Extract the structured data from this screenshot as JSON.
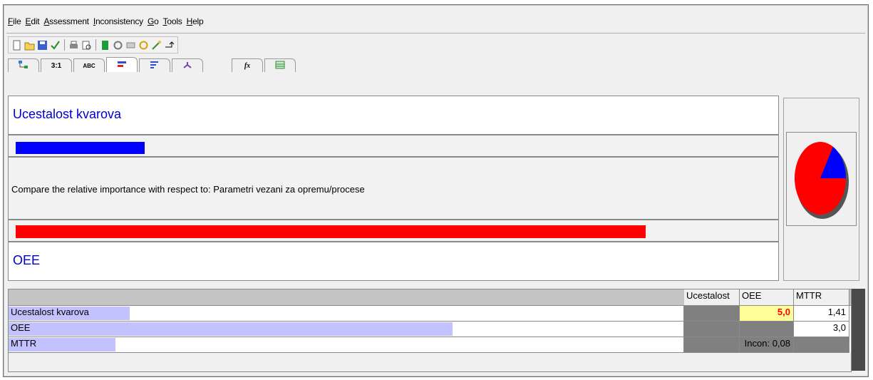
{
  "menu": [
    {
      "label": "File",
      "ul": "F",
      "rest": "ile"
    },
    {
      "label": "Edit",
      "ul": "E",
      "rest": "dit"
    },
    {
      "label": "Assessment",
      "ul": "A",
      "rest": "ssessment"
    },
    {
      "label": "Inconsistency",
      "ul": "I",
      "rest": "nconsistency"
    },
    {
      "label": "Go",
      "ul": "G",
      "rest": "o"
    },
    {
      "label": "Tools",
      "ul": "T",
      "rest": "ools"
    },
    {
      "label": "Help",
      "ul": "H",
      "rest": "elp"
    }
  ],
  "tabs": [
    "tree-icon",
    "3:1",
    "ABC",
    "bar-chart-icon",
    "bars-icon",
    "hierarchy-icon",
    "fx",
    "table-icon"
  ],
  "tab_3to1_label": "3:1",
  "tab_abc_label": "ABC",
  "tab_fx_label": "fx",
  "comparison": {
    "top_label": "Ucestalost kvarova",
    "top_bar_fraction": 0.204,
    "prompt": "Compare the relative importance with respect to: Parametri vezani za opremu/procese",
    "bottom_bar_fraction": 0.998,
    "bottom_label": "OEE",
    "top_bar_color": "#0000ff",
    "bottom_bar_color": "#ff0000"
  },
  "pie": {
    "red_fraction": 0.833,
    "blue_fraction": 0.167,
    "red": "#ff0000",
    "blue": "#0000ff"
  },
  "grid": {
    "columns": [
      "Ucestalost",
      "OEE",
      "MTTR"
    ],
    "rows": [
      {
        "name": "Ucestalost kvarova",
        "bar_fraction": 0.179,
        "ucestalost": "",
        "oee": "5,0",
        "mttr": "1,41"
      },
      {
        "name": "OEE",
        "bar_fraction": 0.657,
        "ucestalost": "",
        "oee": "",
        "mttr": "3,0"
      },
      {
        "name": "MTTR",
        "bar_fraction": 0.158,
        "ucestalost": "",
        "oee": "Incon: 0,08",
        "mttr": ""
      }
    ],
    "highlight_color": "#ffff99",
    "value_red": "#ff0000"
  }
}
